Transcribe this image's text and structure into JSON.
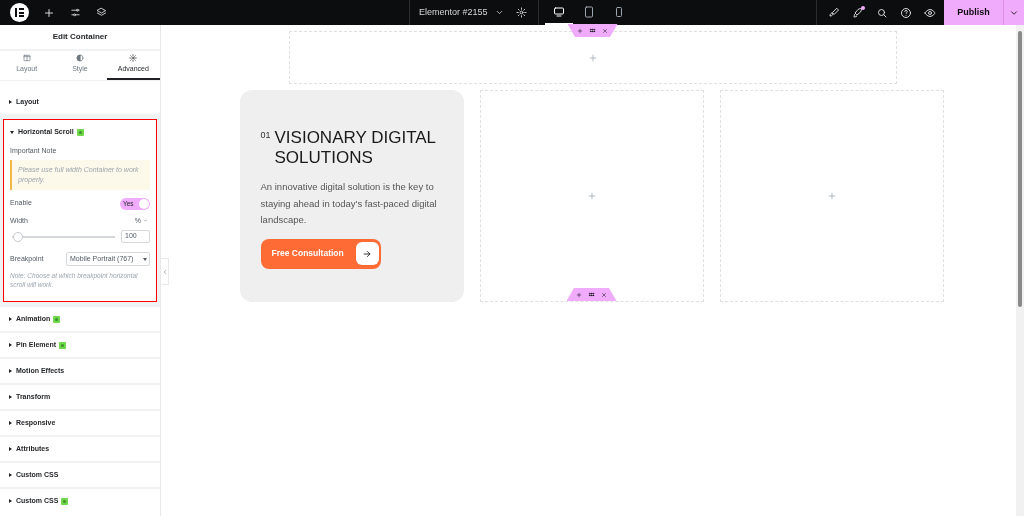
{
  "topbar": {
    "document_title": "Elementor #2155",
    "devices": [
      {
        "kind": "desktop",
        "selected": true
      },
      {
        "kind": "tablet",
        "selected": false
      },
      {
        "kind": "mobile",
        "selected": false
      }
    ],
    "notification": true,
    "publish": "Publish"
  },
  "panel": {
    "title": "Edit Container",
    "tabs": [
      {
        "kind": "layout",
        "label": "Layout",
        "selected": false
      },
      {
        "kind": "style",
        "label": "Style",
        "selected": false
      },
      {
        "kind": "advanced",
        "label": "Advanced",
        "selected": true
      }
    ],
    "sections": [
      {
        "title": "Layout",
        "expanded": false,
        "pro": false,
        "highlighted": false
      },
      {
        "title": "Horizontal Scroll",
        "expanded": true,
        "pro": true,
        "highlighted": true,
        "controls": [
          {
            "kind": "note",
            "label": "Important Note",
            "text": "Please use full width Container to work properly."
          },
          {
            "kind": "switch",
            "label": "Enable",
            "on": true,
            "text": "Yes"
          },
          {
            "kind": "slider",
            "label": "Width",
            "unit": "%",
            "level": 0.06,
            "value": "100"
          },
          {
            "kind": "select",
            "label": "Breakpoint",
            "value": "Mobile Portrait (767)"
          },
          {
            "kind": "hint",
            "text": "Note: Choose at which breakpoint horizontal scroll will work."
          }
        ]
      },
      {
        "title": "Animation",
        "expanded": false,
        "pro": true,
        "highlighted": false
      },
      {
        "title": "Pin Element",
        "expanded": false,
        "pro": true,
        "highlighted": false
      },
      {
        "title": "Motion Effects",
        "expanded": false,
        "pro": false,
        "highlighted": false
      },
      {
        "title": "Transform",
        "expanded": false,
        "pro": false,
        "highlighted": false
      },
      {
        "title": "Responsive",
        "expanded": false,
        "pro": false,
        "highlighted": false
      },
      {
        "title": "Attributes",
        "expanded": false,
        "pro": false,
        "highlighted": false
      },
      {
        "title": "Custom CSS",
        "expanded": false,
        "pro": false,
        "highlighted": false
      },
      {
        "title": "Custom CSS",
        "expanded": false,
        "pro": true,
        "highlighted": false
      }
    ]
  },
  "canvas": {
    "card": {
      "number": "01",
      "heading": "VISIONARY DIGITAL SOLUTIONS",
      "body": "An innovative digital solution is the key to staying ahead in today's fast-paced digital landscape.",
      "button": "Free Consultation"
    }
  }
}
